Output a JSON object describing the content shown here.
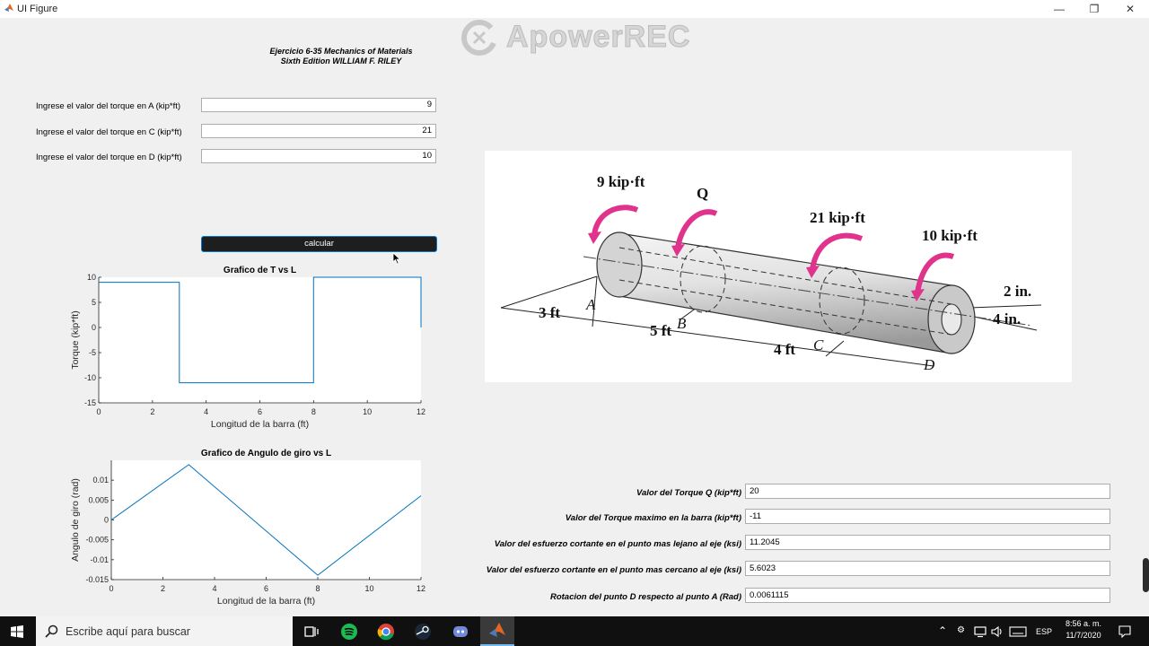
{
  "window": {
    "title": "UI Figure",
    "controls": {
      "minimize": "—",
      "maximize": "❐",
      "close": "✕"
    }
  },
  "watermark": {
    "text": "ApowerREC"
  },
  "header": {
    "line1": "Ejercicio 6-35 Mechanics  of Materials",
    "line2": "Sixth Edition WILLIAM F. RILEY"
  },
  "inputs": [
    {
      "label": "Ingrese el valor del torque en A (kip*ft)",
      "value": "9"
    },
    {
      "label": "Ingrese el valor del torque en C (kip*ft)",
      "value": "21"
    },
    {
      "label": "Ingrese el valor del torque en D (kip*ft)",
      "value": "10"
    }
  ],
  "calc_button": {
    "label": "calcular"
  },
  "diagram": {
    "labels": {
      "tA": "9 kip·ft",
      "q": "Q",
      "tC": "21 kip·ft",
      "tD": "10 kip·ft",
      "d_in": "2 in.",
      "d_out": "4 in.",
      "l1": "3 ft",
      "l2": "5 ft",
      "l3": "4 ft",
      "pA": "A",
      "pB": "B",
      "pC": "C",
      "pD": "D"
    }
  },
  "results": [
    {
      "label": "Valor del Torque Q (kip*ft)",
      "value": "20"
    },
    {
      "label": "Valor del Torque maximo en la barra (kip*ft)",
      "value": "-11"
    },
    {
      "label": "Valor del esfuerzo cortante en el punto mas lejano al eje  (ksi)",
      "value": "11.2045"
    },
    {
      "label": "Valor del esfuerzo cortante en el punto mas cercano al eje  (ksi)",
      "value": "5.6023"
    },
    {
      "label": "Rotacion del punto D respecto al punto A (Rad)",
      "value": "0.0061115"
    }
  ],
  "chart_data": [
    {
      "type": "line",
      "title": "Grafico de T vs L",
      "xlabel": "Longitud de la barra (ft)",
      "ylabel": "Torque (kip*ft)",
      "xlim": [
        0,
        12
      ],
      "ylim": [
        -15,
        10
      ],
      "xticks": [
        0,
        2,
        4,
        6,
        8,
        10,
        12
      ],
      "yticks": [
        10,
        5,
        0,
        -5,
        -10,
        -15
      ],
      "x": [
        0,
        3,
        3,
        8,
        8,
        12,
        12
      ],
      "y": [
        9,
        9,
        -11,
        -11,
        10,
        10,
        0
      ],
      "color": "#0072bd",
      "grid": false
    },
    {
      "type": "line",
      "title": "Grafico de Angulo de giro vs L",
      "xlabel": "Longitud de la barra (ft)",
      "ylabel": "Angulo de giro (rad)",
      "xlim": [
        0,
        12
      ],
      "ylim": [
        -0.015,
        0.015
      ],
      "xticks": [
        0,
        2,
        4,
        6,
        8,
        10,
        12
      ],
      "yticks": [
        0.01,
        0.005,
        0,
        -0.005,
        -0.01,
        -0.015
      ],
      "ytick_labels": [
        "0.01",
        "0.005",
        "0",
        "-0.005",
        "-0.01",
        "-0.015"
      ],
      "x": [
        0,
        3,
        8,
        12
      ],
      "y": [
        0,
        0.0139,
        -0.0139,
        0.0061
      ],
      "color": "#0072bd",
      "grid": false
    }
  ],
  "taskbar": {
    "search_placeholder": "Escribe aquí para buscar",
    "language": "ESP",
    "time": "8:56 a. m.",
    "date": "11/7/2020"
  }
}
